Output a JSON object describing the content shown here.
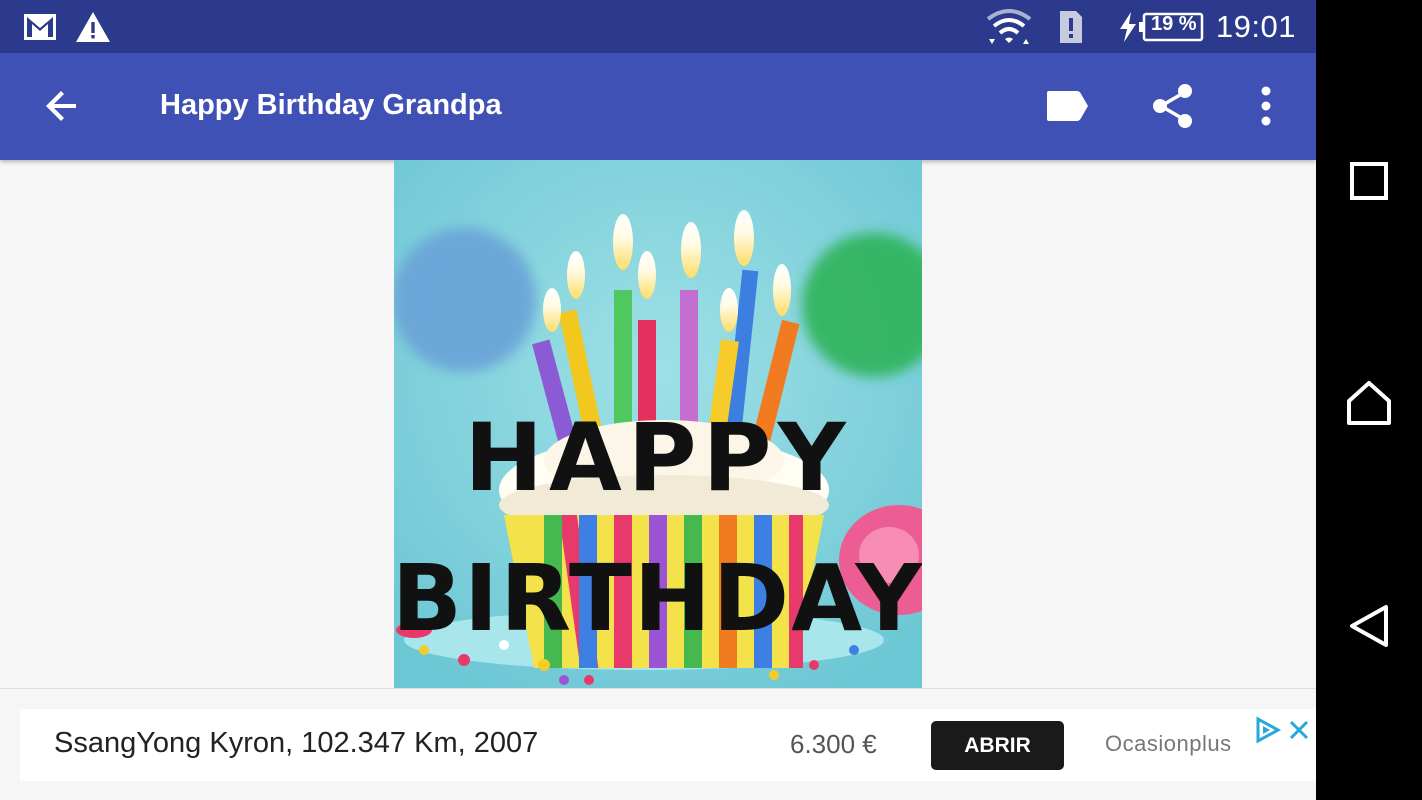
{
  "status_bar": {
    "time": "19:01",
    "battery_percent": "19 %",
    "icons": [
      "gmail-icon",
      "warning-icon",
      "wifi-icon",
      "sim-alert-icon",
      "charging-icon",
      "battery-icon"
    ]
  },
  "app_bar": {
    "title": "Happy Birthday Grandpa",
    "icons": [
      "back-arrow-icon",
      "label-icon",
      "share-icon",
      "more-vert-icon"
    ],
    "color": "#3f51b5"
  },
  "card_image": {
    "line1": "HAPPY",
    "line2": "BIRTHDAY"
  },
  "ad": {
    "text": "SsangYong Kyron, 102.347 Km, 2007",
    "price": "6.300 €",
    "button_label": "ABRIR",
    "advertiser": "Ocasionplus",
    "icons": [
      "ad-choices-icon",
      "close-icon"
    ]
  },
  "nav_bar": {
    "icons": [
      "recents-icon",
      "home-icon",
      "back-icon"
    ]
  }
}
